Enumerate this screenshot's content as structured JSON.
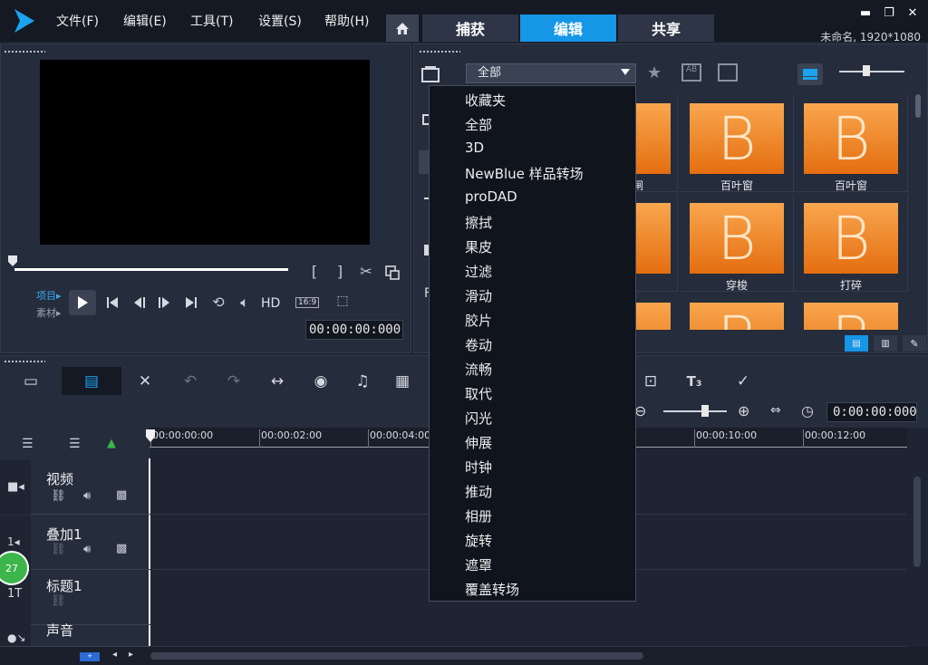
{
  "menu": {
    "items": [
      "文件(F)",
      "编辑(E)",
      "工具(T)",
      "设置(S)",
      "帮助(H)"
    ]
  },
  "tabs": [
    "捕获",
    "编辑",
    "共享"
  ],
  "active_tab": "编辑",
  "project_info": "未命名, 1920*1080",
  "player": {
    "mode_project": "项目▸",
    "mode_clip": "素材▸",
    "hd_label": "HD",
    "ratio_label": "16:9",
    "timecode": "00:00:00:000"
  },
  "library": {
    "dropdown_selected": "全部",
    "dropdown_items": [
      "收藏夹",
      "全部",
      "3D",
      "NewBlue 样品转场",
      "proDAD",
      "擦拭",
      "果皮",
      "过滤",
      "滑动",
      "胶片",
      "卷动",
      "流畅",
      "取代",
      "闪光",
      "伸展",
      "时钟",
      "推动",
      "相册",
      "旋转",
      "遮罩",
      "覆盖转场"
    ],
    "thumbnails": [
      {
        "letter": "B",
        "label": "百叶窗"
      },
      {
        "letter": "B",
        "label": "百叶窗"
      },
      {
        "letter": "B",
        "label": "穿梭"
      },
      {
        "letter": "B",
        "label": "打碎"
      },
      {
        "letter": "B",
        "label": ""
      },
      {
        "letter": "B",
        "label": ""
      }
    ],
    "partial_labels": [
      "闸"
    ]
  },
  "timeline": {
    "timecode": "0:00:00:000",
    "ruler": [
      "00:00:00:00",
      "00:00:02:00",
      "00:00:04:00",
      "00:00:10:00",
      "00:00:12:00"
    ],
    "tracks": [
      {
        "name": "视频"
      },
      {
        "name": "叠加1"
      },
      {
        "name": "标题1"
      },
      {
        "name": "声音"
      }
    ],
    "badge": "27"
  },
  "colors": {
    "accent": "#1596e6",
    "thumb_orange": "#f38a24",
    "badge_green": "#3cb54a"
  }
}
